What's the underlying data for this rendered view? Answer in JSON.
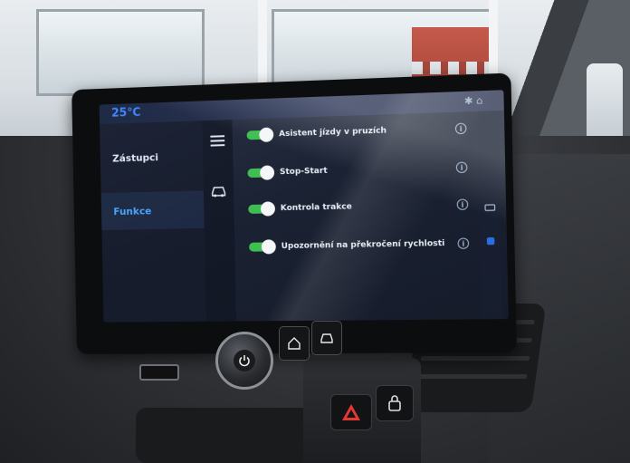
{
  "status": {
    "temperature": "25℃"
  },
  "sidebar": {
    "items": [
      {
        "label": "Zástupci",
        "active": false
      },
      {
        "label": "Funkce",
        "active": true
      }
    ]
  },
  "features": [
    {
      "label": "Asistent jízdy v pruzích",
      "enabled": true
    },
    {
      "label": "Stop-Start",
      "enabled": true
    },
    {
      "label": "Kontrola trakce",
      "enabled": true
    },
    {
      "label": "Upozornění na překročení rychlosti",
      "enabled": true
    }
  ],
  "colors": {
    "accent": "#4aa3ff",
    "toggle_on": "#3fbf52",
    "temperature": "#3f86ff"
  },
  "icons": [
    "menu-icon",
    "car-icon",
    "info-icon",
    "bluetooth-icon",
    "home-icon",
    "power-icon",
    "hazard-icon",
    "lock-icon"
  ]
}
